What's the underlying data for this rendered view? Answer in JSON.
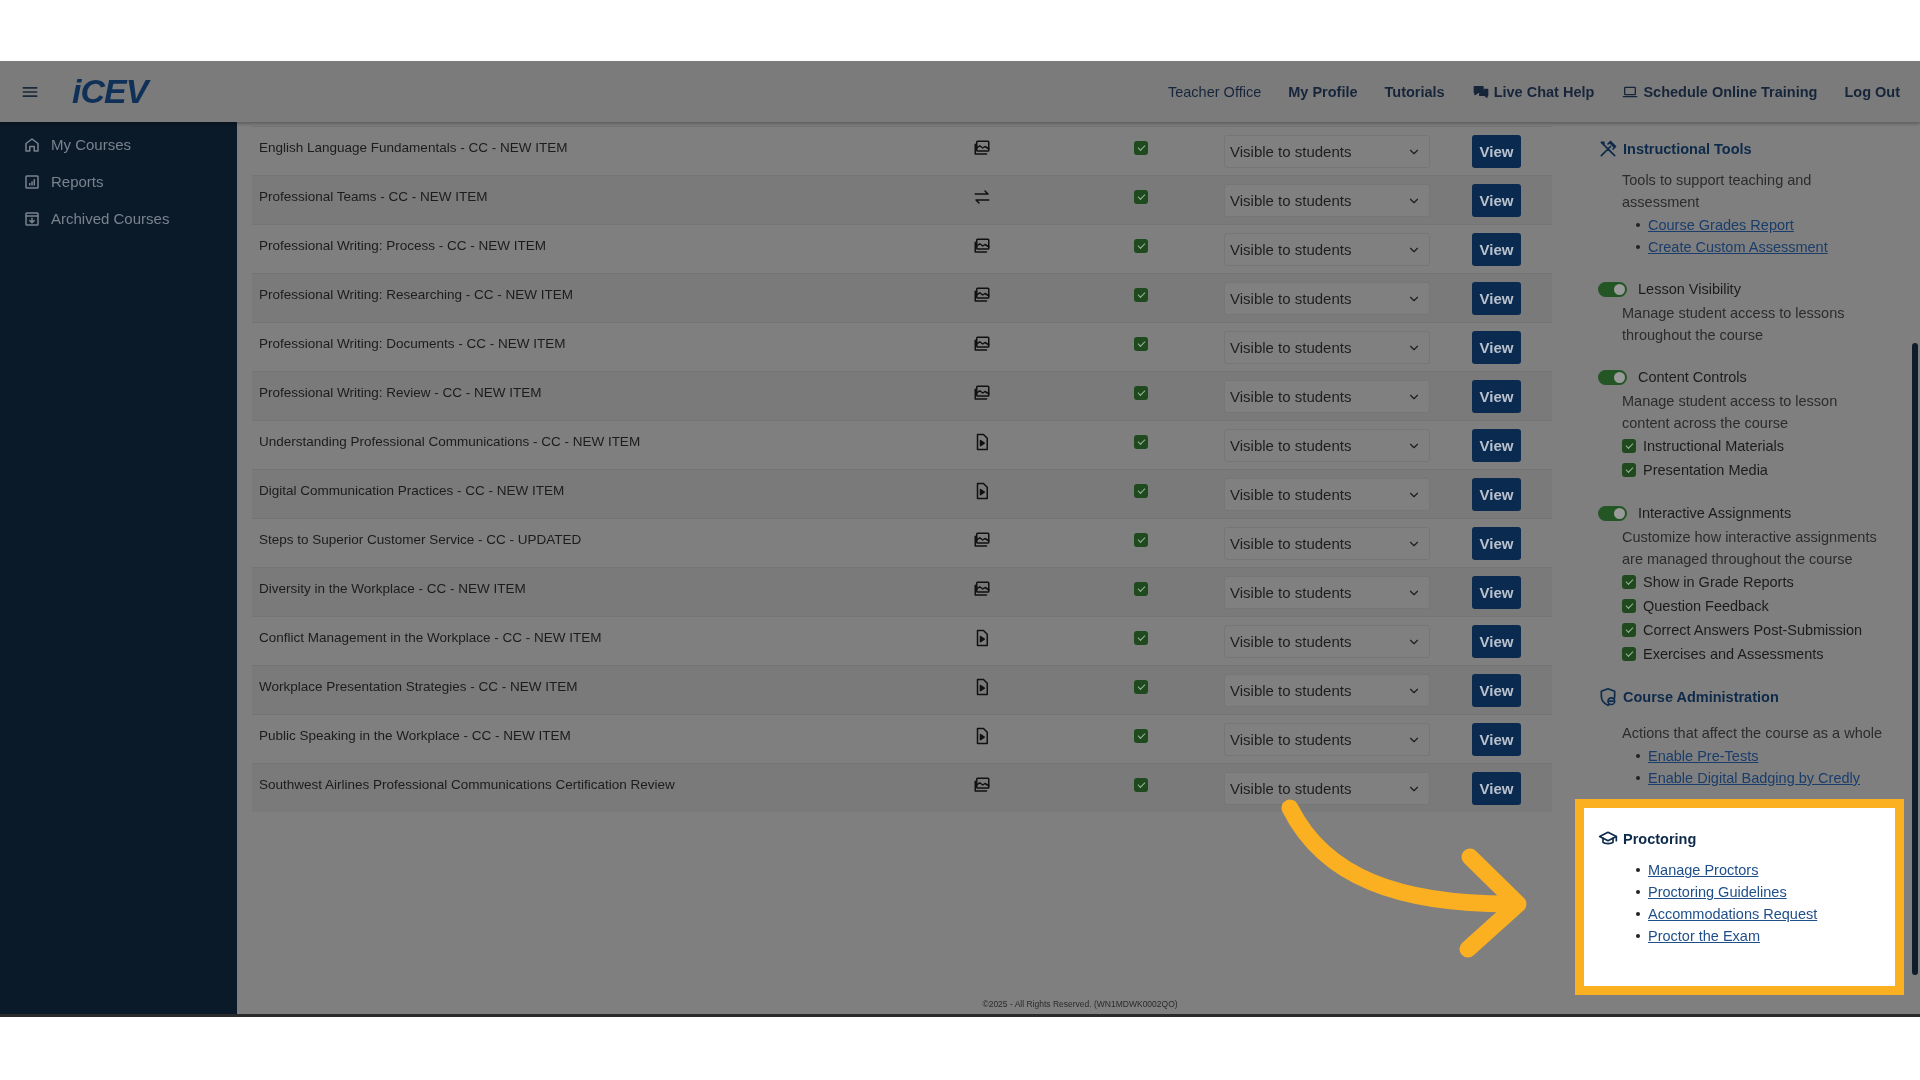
{
  "header": {
    "logo": "iCEV",
    "nav": [
      {
        "label": "Teacher Office",
        "kind": "plain"
      },
      {
        "label": "My Profile",
        "kind": "bold"
      },
      {
        "label": "Tutorials",
        "kind": "bold"
      },
      {
        "label": "Live Chat Help",
        "kind": "chat"
      },
      {
        "label": "Schedule Online Training",
        "kind": "laptop"
      },
      {
        "label": "Log Out",
        "kind": "bold"
      }
    ]
  },
  "sidebar": {
    "items": [
      {
        "label": "My Courses",
        "kind": "home"
      },
      {
        "label": "Reports",
        "kind": "report"
      },
      {
        "label": "Archived Courses",
        "kind": "archive"
      }
    ]
  },
  "table": {
    "rows": [
      {
        "title": "English Language Fundamentals - CC - NEW ITEM",
        "kind": "media",
        "checked": true,
        "visibility": "Visible to students",
        "action": "View"
      },
      {
        "title": "Professional Teams - CC - NEW ITEM",
        "kind": "interactive",
        "checked": true,
        "visibility": "Visible to students",
        "action": "View"
      },
      {
        "title": "Professional Writing: Process - CC - NEW ITEM",
        "kind": "media",
        "checked": true,
        "visibility": "Visible to students",
        "action": "View"
      },
      {
        "title": "Professional Writing: Researching - CC - NEW ITEM",
        "kind": "media",
        "checked": true,
        "visibility": "Visible to students",
        "action": "View"
      },
      {
        "title": "Professional Writing: Documents - CC - NEW ITEM",
        "kind": "media",
        "checked": true,
        "visibility": "Visible to students",
        "action": "View"
      },
      {
        "title": "Professional Writing: Review - CC - NEW ITEM",
        "kind": "media",
        "checked": true,
        "visibility": "Visible to students",
        "action": "View"
      },
      {
        "title": "Understanding Professional Communications - CC - NEW ITEM",
        "kind": "document",
        "checked": true,
        "visibility": "Visible to students",
        "action": "View"
      },
      {
        "title": "Digital Communication Practices - CC - NEW ITEM",
        "kind": "document",
        "checked": true,
        "visibility": "Visible to students",
        "action": "View"
      },
      {
        "title": "Steps to Superior Customer Service - CC - UPDATED",
        "kind": "media",
        "checked": true,
        "visibility": "Visible to students",
        "action": "View"
      },
      {
        "title": "Diversity in the Workplace - CC - NEW ITEM",
        "kind": "media",
        "checked": true,
        "visibility": "Visible to students",
        "action": "View"
      },
      {
        "title": "Conflict Management in the Workplace - CC - NEW ITEM",
        "kind": "document",
        "checked": true,
        "visibility": "Visible to students",
        "action": "View"
      },
      {
        "title": "Workplace Presentation Strategies - CC - NEW ITEM",
        "kind": "document",
        "checked": true,
        "visibility": "Visible to students",
        "action": "View"
      },
      {
        "title": "Public Speaking in the Workplace - CC - NEW ITEM",
        "kind": "document",
        "checked": true,
        "visibility": "Visible to students",
        "action": "View"
      },
      {
        "title": "Southwest Airlines Professional Communications Certification Review",
        "kind": "media",
        "checked": true,
        "visibility": "Visible to students",
        "action": "View"
      }
    ]
  },
  "panel": {
    "sections": [
      {
        "kind": "tools",
        "title": "Instructional Tools",
        "description": "Tools to support teaching and assessment",
        "links": [
          "Course Grades Report",
          "Create Custom Assessment"
        ]
      },
      {
        "kind": "toggle",
        "title": "Lesson Visibility",
        "on": true,
        "description": "Manage student access to lessons throughout the course"
      },
      {
        "kind": "toggle",
        "title": "Content Controls",
        "on": true,
        "description": "Manage student access to lesson content across the course",
        "options": [
          {
            "label": "Instructional Materials",
            "checked": true
          },
          {
            "label": "Presentation Media",
            "checked": true
          }
        ]
      },
      {
        "kind": "toggle",
        "title": "Interactive Assignments",
        "on": true,
        "description": "Customize how interactive assignments are managed throughout the course",
        "options": [
          {
            "label": "Show in Grade Reports",
            "checked": true
          },
          {
            "label": "Question Feedback",
            "checked": true
          },
          {
            "label": "Correct Answers Post-Submission",
            "checked": true
          },
          {
            "label": "Exercises and Assessments",
            "checked": true
          }
        ]
      },
      {
        "kind": "admin",
        "title": "Course Administration",
        "description": "Actions that affect the course as a whole",
        "links": [
          "Enable Pre-Tests",
          "Enable Digital Badging by Credly"
        ]
      },
      {
        "kind": "proctoring",
        "title": "Proctoring",
        "highlighted": true,
        "links": [
          "Manage Proctors",
          "Proctoring Guidelines",
          "Accommodations Request",
          "Proctor the Exam"
        ]
      }
    ]
  },
  "footer": "©2025 - All Rights Reserved. (WN1MDWK0002QO)"
}
